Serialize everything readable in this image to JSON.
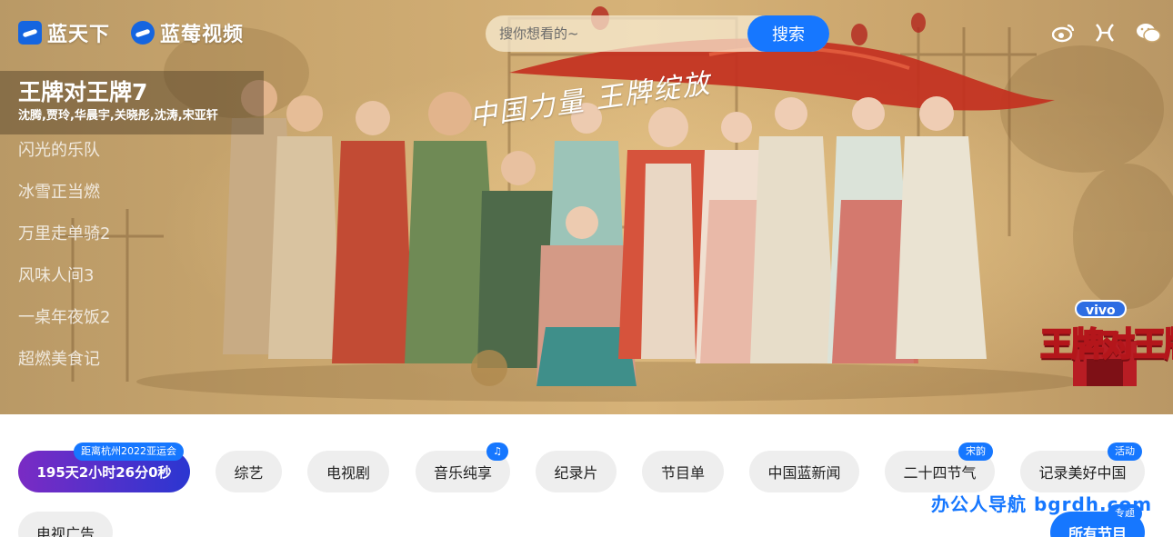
{
  "header": {
    "logo_primary": "蓝天下",
    "logo_secondary": "蓝莓视频",
    "search": {
      "placeholder": "搜你想看的~",
      "button": "搜索"
    },
    "social_icons": [
      "weibo-icon",
      "x-icon",
      "wechat-icon"
    ]
  },
  "hero": {
    "active_show": {
      "title": "王牌对王牌7",
      "cast": "沈腾,贾玲,华晨宇,关晓彤,沈涛,宋亚轩"
    },
    "show_list": [
      "闪光的乐队",
      "冰雪正当燃",
      "万里走单骑2",
      "风味人间3",
      "一桌年夜饭2",
      "超燃美食记"
    ],
    "slogan": "中国力量 王牌绽放",
    "badge": {
      "sponsor": "vivo",
      "title": "王牌对王牌"
    }
  },
  "categories": {
    "countdown": {
      "label": "195天2小时26分0秒",
      "tag": "距离杭州2022亚运会"
    },
    "items": [
      {
        "label": "综艺",
        "tag": ""
      },
      {
        "label": "电视剧",
        "tag": ""
      },
      {
        "label": "音乐纯享",
        "tag": "♫"
      },
      {
        "label": "纪录片",
        "tag": ""
      },
      {
        "label": "节目单",
        "tag": ""
      },
      {
        "label": "中国蓝新闻",
        "tag": ""
      },
      {
        "label": "二十四节气",
        "tag": "宋韵"
      },
      {
        "label": "记录美好中国",
        "tag": "活动"
      }
    ],
    "second_row": [
      {
        "label": "电视广告",
        "tag": ""
      },
      {
        "label": "所有节目",
        "tag": "专题"
      }
    ],
    "watermark": "办公人导航 bgrdh.com"
  },
  "colors": {
    "accent": "#1677ff",
    "countdown_start": "#7a2bc4",
    "countdown_end": "#2b36d1"
  }
}
